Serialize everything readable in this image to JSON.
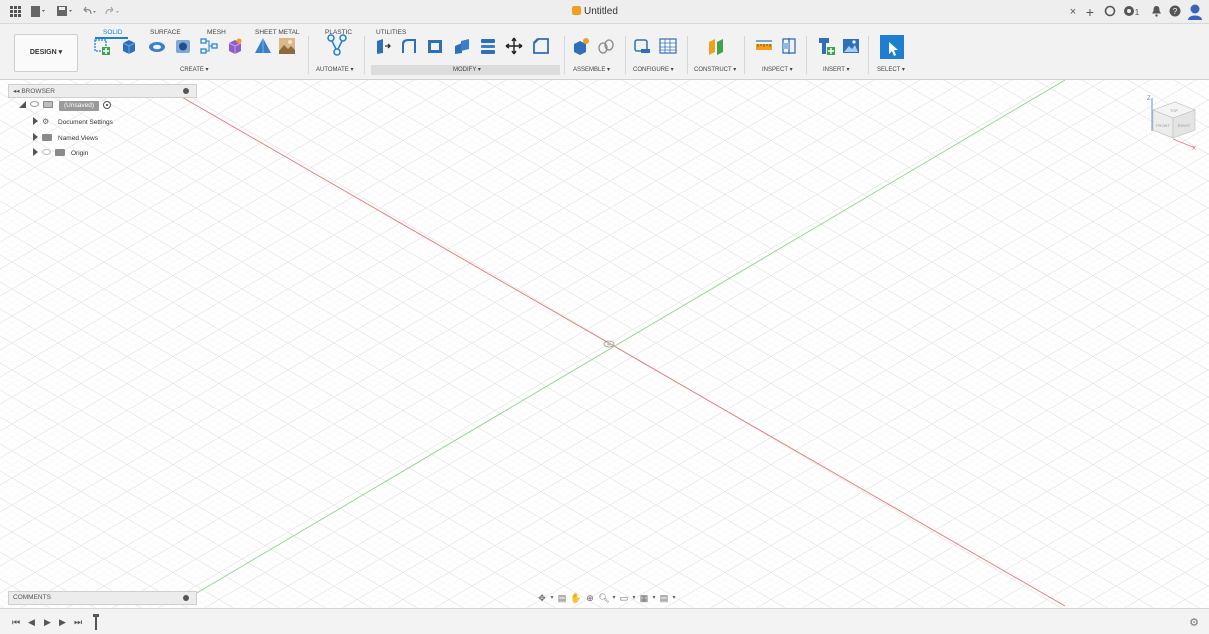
{
  "window": {
    "title": "Untitled"
  },
  "quick_access": {
    "grid_icon": "app-grid-icon",
    "file_icon": "file-menu-icon",
    "save_icon": "save-icon",
    "undo_icon": "undo-icon",
    "redo_icon": "redo-icon"
  },
  "top_right": {
    "close": "×",
    "new_tab": "+",
    "job_status": "1"
  },
  "workspace": {
    "label": "DESIGN ▾"
  },
  "tabs": [
    {
      "label": "SOLID",
      "active": true
    },
    {
      "label": "SURFACE"
    },
    {
      "label": "MESH"
    },
    {
      "label": "SHEET METAL"
    },
    {
      "label": "PLASTIC"
    },
    {
      "label": "UTILITIES"
    }
  ],
  "groups": {
    "create": "CREATE ▾",
    "automate": "AUTOMATE ▾",
    "modify": "MODIFY ▾",
    "assemble": "ASSEMBLE ▾",
    "configure": "CONFIGURE ▾",
    "construct": "CONSTRUCT ▾",
    "inspect": "INSPECT ▾",
    "insert": "INSERT ▾",
    "select": "SELECT ▾"
  },
  "browser": {
    "header": "BROWSER",
    "root": "(Unsaved)",
    "items": [
      {
        "label": "Document Settings"
      },
      {
        "label": "Named Views"
      },
      {
        "label": "Origin"
      }
    ]
  },
  "comments": {
    "header": "COMMENTS"
  },
  "view_cube": {
    "top": "TOP",
    "front": "FRONT",
    "right": "RIGHT",
    "axis_z": "Z",
    "axis_x": "X"
  },
  "colors": {
    "accent": "#1e7fd1",
    "x_axis": "#e57373",
    "y_axis": "#7fd07f",
    "grid": "#dcdcdc"
  }
}
